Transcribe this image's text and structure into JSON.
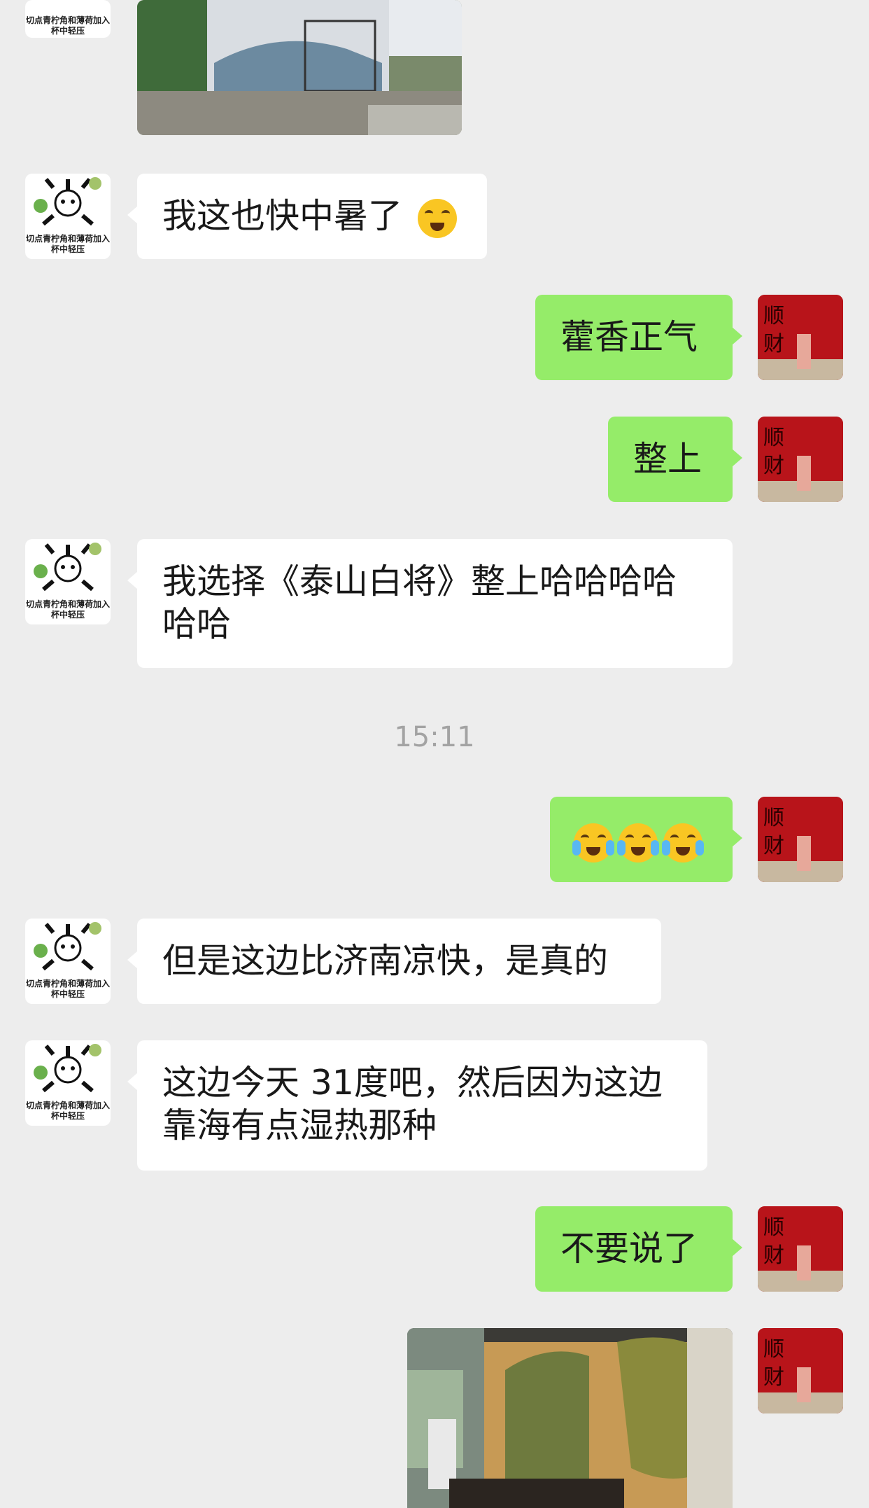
{
  "messages": [
    {
      "id": "m1",
      "side": "left",
      "text": "我这也快中暑了"
    },
    {
      "id": "m2",
      "side": "right",
      "text": "藿香正气"
    },
    {
      "id": "m3",
      "side": "right",
      "text": "整上"
    },
    {
      "id": "m4",
      "side": "left",
      "text": "我选择《泰山白将》整上哈哈哈哈哈哈"
    },
    {
      "id": "m5",
      "side": "right",
      "text": "😭😭😭"
    },
    {
      "id": "m6",
      "side": "left",
      "text": "但是这边比济南凉快，是真的"
    },
    {
      "id": "m7",
      "side": "left",
      "text": "这边今天 31度吧，然后因为这边靠海有点湿热那种"
    },
    {
      "id": "m8",
      "side": "right",
      "text": "不要说了"
    }
  ],
  "timestamp": "15:11",
  "avatar_left_caption": "切点青柠角和薄荷加入杯中轻压",
  "avatar_right_text": "顺财",
  "emoji_names": [
    "laughing-crying-face-icon",
    "laughing-crying-face-icon",
    "laughing-crying-face-icon"
  ],
  "colors": {
    "background": "#ededed",
    "bubble_self": "#95ec69",
    "bubble_other": "#ffffff",
    "timestamp": "#a3a3a3"
  }
}
